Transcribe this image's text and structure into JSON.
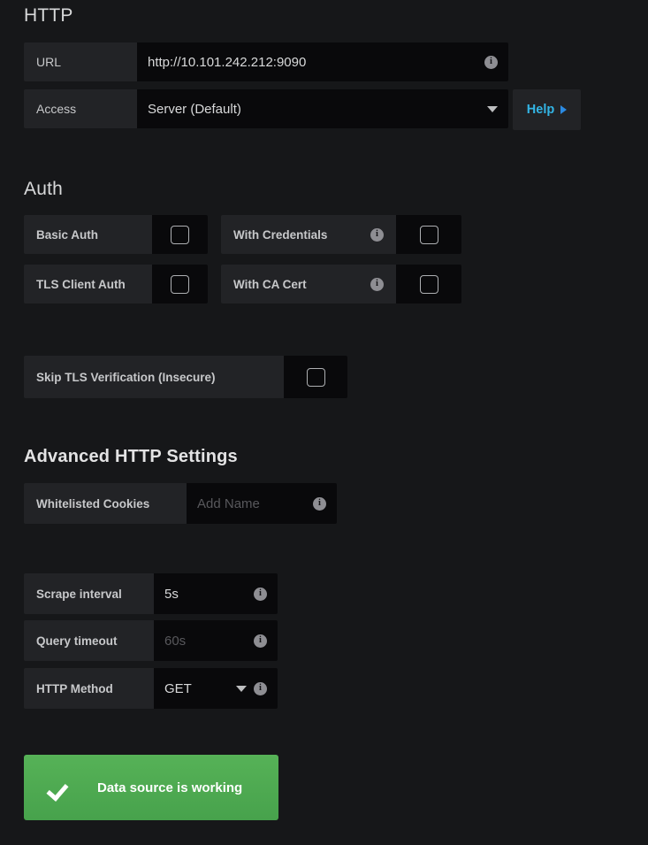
{
  "http": {
    "heading": "HTTP",
    "url": {
      "label": "URL",
      "value": "http://10.101.242.212:9090",
      "info_icon": "info-icon"
    },
    "access": {
      "label": "Access",
      "value": "Server (Default)",
      "caret_icon": "chevron-down-icon"
    },
    "help": {
      "label": "Help",
      "arrow_icon": "triangle-right-icon"
    }
  },
  "auth": {
    "heading": "Auth",
    "basic_auth": {
      "label": "Basic Auth",
      "checked": false
    },
    "tls_client_auth": {
      "label": "TLS Client Auth",
      "checked": false
    },
    "with_credentials": {
      "label": "With Credentials",
      "checked": false,
      "info_icon": "info-icon"
    },
    "with_ca_cert": {
      "label": "With CA Cert",
      "checked": false,
      "info_icon": "info-icon"
    },
    "skip_tls_verification": {
      "label": "Skip TLS Verification (Insecure)",
      "checked": false
    }
  },
  "advanced": {
    "heading": "Advanced HTTP Settings",
    "whitelisted_cookies": {
      "label": "Whitelisted Cookies",
      "value": "",
      "placeholder": "Add Name",
      "info_icon": "info-icon"
    },
    "scrape_interval": {
      "label": "Scrape interval",
      "value": "5s",
      "info_icon": "info-icon"
    },
    "query_timeout": {
      "label": "Query timeout",
      "value": "",
      "placeholder": "60s",
      "info_icon": "info-icon"
    },
    "http_method": {
      "label": "HTTP Method",
      "value": "GET",
      "caret_icon": "chevron-down-icon",
      "info_icon": "info-icon"
    }
  },
  "status": {
    "message": "Data source is working",
    "icon": "check-icon",
    "color": "#4ca84f"
  },
  "colors": {
    "background": "#161719",
    "label_bg": "#222326",
    "input_bg": "#09090b",
    "accent_link": "#33b5e5",
    "success": "#4ca84f"
  }
}
